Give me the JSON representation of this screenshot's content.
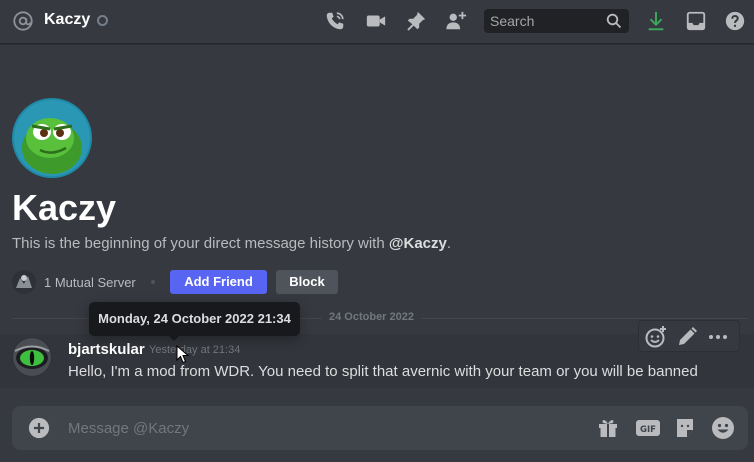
{
  "header": {
    "title": "Kaczy",
    "search_placeholder": "Search",
    "icons": [
      "at-icon",
      "status-idle-icon",
      "voice-call-icon",
      "video-call-icon",
      "pin-icon",
      "add-member-icon",
      "search-icon",
      "download-icon",
      "inbox-icon",
      "help-icon"
    ]
  },
  "profile": {
    "name": "Kaczy",
    "description_prefix": "This is the beginning of your direct message history with ",
    "mention": "@Kaczy",
    "description_suffix": ".",
    "mutual_servers": "1 Mutual Server",
    "add_friend_label": "Add Friend",
    "block_label": "Block"
  },
  "divider": {
    "date": "24 October 2022"
  },
  "tooltip": {
    "text": "Monday, 24 October 2022 21:34"
  },
  "message": {
    "author": "bjartskular",
    "timestamp": "Yesterday at 21:34",
    "text": "Hello, I'm a mod from WDR. You need to split that avernic with your team or you will be banned"
  },
  "composer": {
    "placeholder": "Message @Kaczy",
    "icons": [
      "add-attachment-icon",
      "gift-icon",
      "gif-icon",
      "sticker-icon",
      "emoji-icon"
    ]
  },
  "colors": {
    "background": "#36393f",
    "brand": "#5865f2",
    "block_button": "#4f545c",
    "download_green": "#3ba55d",
    "status_idle": "#747f8d"
  }
}
